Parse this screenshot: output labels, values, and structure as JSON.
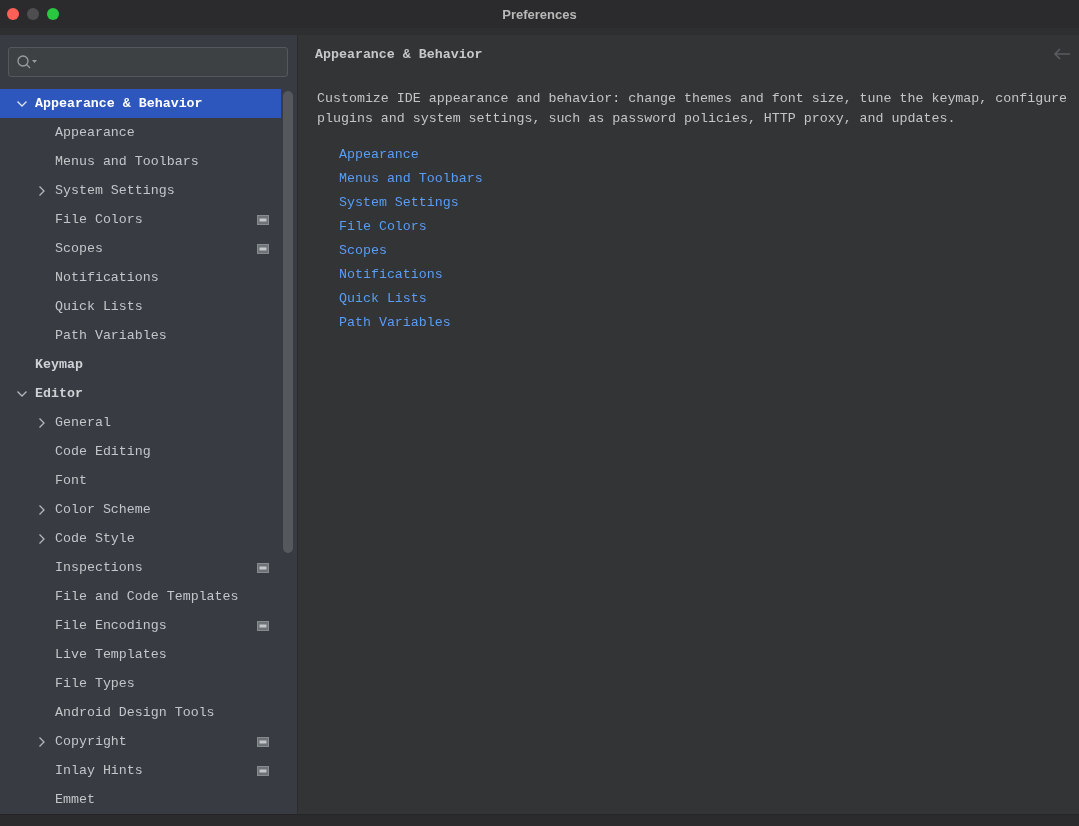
{
  "window": {
    "title": "Preferences"
  },
  "tree": [
    {
      "label": "Appearance & Behavior",
      "kind": "folder",
      "expanded": true,
      "selected": true,
      "project_icon": false,
      "children": [
        {
          "label": "Appearance",
          "kind": "page",
          "selected": false,
          "project_icon": false
        },
        {
          "label": "Menus and Toolbars",
          "kind": "page",
          "selected": false,
          "project_icon": false
        },
        {
          "label": "System Settings",
          "kind": "folder",
          "expanded": false,
          "selected": false,
          "project_icon": false
        },
        {
          "label": "File Colors",
          "kind": "page",
          "selected": false,
          "project_icon": true
        },
        {
          "label": "Scopes",
          "kind": "page",
          "selected": false,
          "project_icon": true
        },
        {
          "label": "Notifications",
          "kind": "page",
          "selected": false,
          "project_icon": false
        },
        {
          "label": "Quick Lists",
          "kind": "page",
          "selected": false,
          "project_icon": false
        },
        {
          "label": "Path Variables",
          "kind": "page",
          "selected": false,
          "project_icon": false
        }
      ]
    },
    {
      "label": "Keymap",
      "kind": "page",
      "selected": false,
      "project_icon": false
    },
    {
      "label": "Editor",
      "kind": "folder",
      "expanded": true,
      "selected": false,
      "project_icon": false,
      "children": [
        {
          "label": "General",
          "kind": "folder",
          "expanded": false,
          "selected": false,
          "project_icon": false
        },
        {
          "label": "Code Editing",
          "kind": "page",
          "selected": false,
          "project_icon": false
        },
        {
          "label": "Font",
          "kind": "page",
          "selected": false,
          "project_icon": false
        },
        {
          "label": "Color Scheme",
          "kind": "folder",
          "expanded": false,
          "selected": false,
          "project_icon": false
        },
        {
          "label": "Code Style",
          "kind": "folder",
          "expanded": false,
          "selected": false,
          "project_icon": false
        },
        {
          "label": "Inspections",
          "kind": "page",
          "selected": false,
          "project_icon": true
        },
        {
          "label": "File and Code Templates",
          "kind": "page",
          "selected": false,
          "project_icon": false
        },
        {
          "label": "File Encodings",
          "kind": "page",
          "selected": false,
          "project_icon": true
        },
        {
          "label": "Live Templates",
          "kind": "page",
          "selected": false,
          "project_icon": false
        },
        {
          "label": "File Types",
          "kind": "page",
          "selected": false,
          "project_icon": false
        },
        {
          "label": "Android Design Tools",
          "kind": "page",
          "selected": false,
          "project_icon": false
        },
        {
          "label": "Copyright",
          "kind": "folder",
          "expanded": false,
          "selected": false,
          "project_icon": true
        },
        {
          "label": "Inlay Hints",
          "kind": "page",
          "selected": false,
          "project_icon": true
        },
        {
          "label": "Emmet",
          "kind": "page",
          "selected": false,
          "project_icon": false
        }
      ]
    }
  ],
  "content": {
    "title": "Appearance & Behavior",
    "description": "Customize IDE appearance and behavior: change themes and font size, tune the keymap, configure plugins and system settings, such as password policies, HTTP proxy, and updates.",
    "links": [
      "Appearance",
      "Menus and Toolbars",
      "System Settings",
      "File Colors",
      "Scopes",
      "Notifications",
      "Quick Lists",
      "Path Variables"
    ]
  }
}
